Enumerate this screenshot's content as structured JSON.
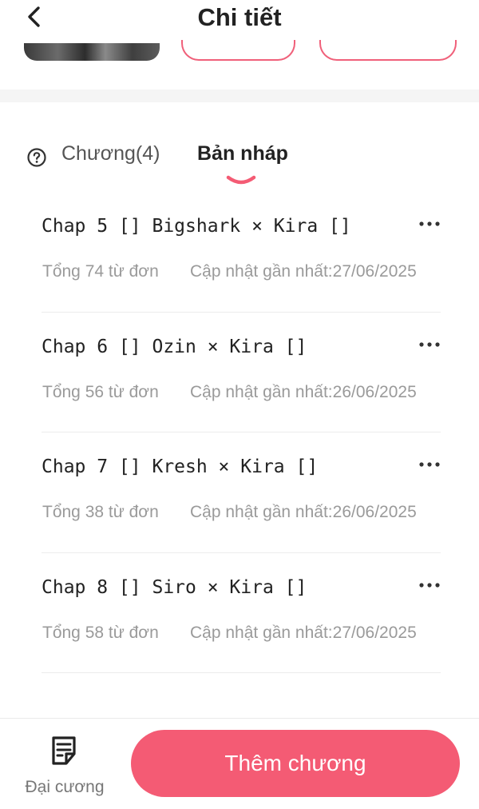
{
  "header": {
    "title": "Chi tiết",
    "back_icon": "chevron-left-icon"
  },
  "tabs": {
    "help_icon": "question-circle-icon",
    "chapters_label": "Chương(4)",
    "drafts_label": "Bản nháp",
    "active": "drafts",
    "accent_color": "#f45b74"
  },
  "chapters": [
    {
      "title": "Chap 5 [] Bigshark × Kira []",
      "words": "Tổng 74 từ đơn",
      "updated": "Cập nhật gần nhất:27/06/2025"
    },
    {
      "title": "Chap 6 [] Ozin × Kira []",
      "words": "Tổng 56 từ đơn",
      "updated": "Cập nhật gần nhất:26/06/2025"
    },
    {
      "title": "Chap 7 [] Kresh × Kira []",
      "words": "Tổng 38 từ đơn",
      "updated": "Cập nhật gần nhất:26/06/2025"
    },
    {
      "title": "Chap 8 [] Siro × Kira []",
      "words": "Tổng 58 từ đơn",
      "updated": "Cập nhật gần nhất:27/06/2025"
    }
  ],
  "bottom_bar": {
    "outline_label": "Đại cương",
    "outline_icon": "document-list-icon",
    "add_chapter_label": "Thêm chương",
    "button_color": "#f45b74"
  }
}
